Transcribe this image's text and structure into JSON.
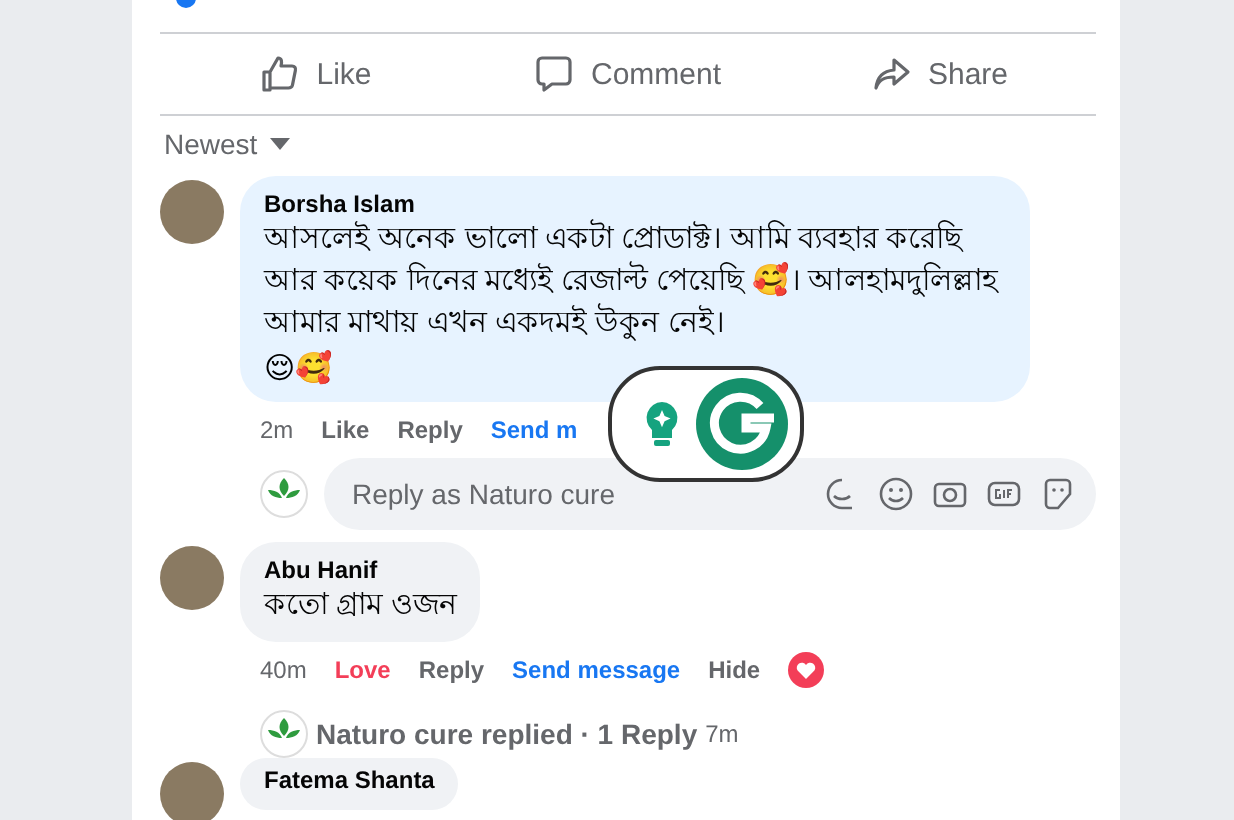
{
  "actions": [
    {
      "label": "Like"
    },
    {
      "label": "Comment"
    },
    {
      "label": "Share"
    }
  ],
  "sort": {
    "label": "Newest"
  },
  "comments": [
    {
      "name": "Borsha Islam",
      "text": "আসলেই অনেক ভালো একটা প্রোডাক্ট। আমি ব্যবহার করেছি আর কয়েক দিনের মধ্যেই রেজাল্ট পেয়েছি 🥰। আলহামদুলিল্লাহ আমার মাথায় এখন একদমই উকুন নেই।",
      "emoji": "😌🥰",
      "links": [
        {
          "label": "2m",
          "kind": "time"
        },
        {
          "label": "Like",
          "kind": "action"
        },
        {
          "label": "Reply",
          "kind": "action"
        },
        {
          "label": "Send m",
          "kind": "message"
        }
      ],
      "reply_box": {
        "placeholder": "Reply as Naturo cure"
      }
    },
    {
      "name": "Abu Hanif",
      "text": "কতো গ্রাম ওজন",
      "links": [
        {
          "label": "40m",
          "kind": "time"
        },
        {
          "label": "Love",
          "kind": "love"
        },
        {
          "label": "Reply",
          "kind": "action"
        },
        {
          "label": "Send message",
          "kind": "message"
        },
        {
          "label": "Hide",
          "kind": "action"
        }
      ],
      "reaction": true,
      "replies": {
        "label": "Naturo cure replied · 1 Reply",
        "time": "7m"
      }
    },
    {
      "name": "Fatema Shanta"
    }
  ]
}
